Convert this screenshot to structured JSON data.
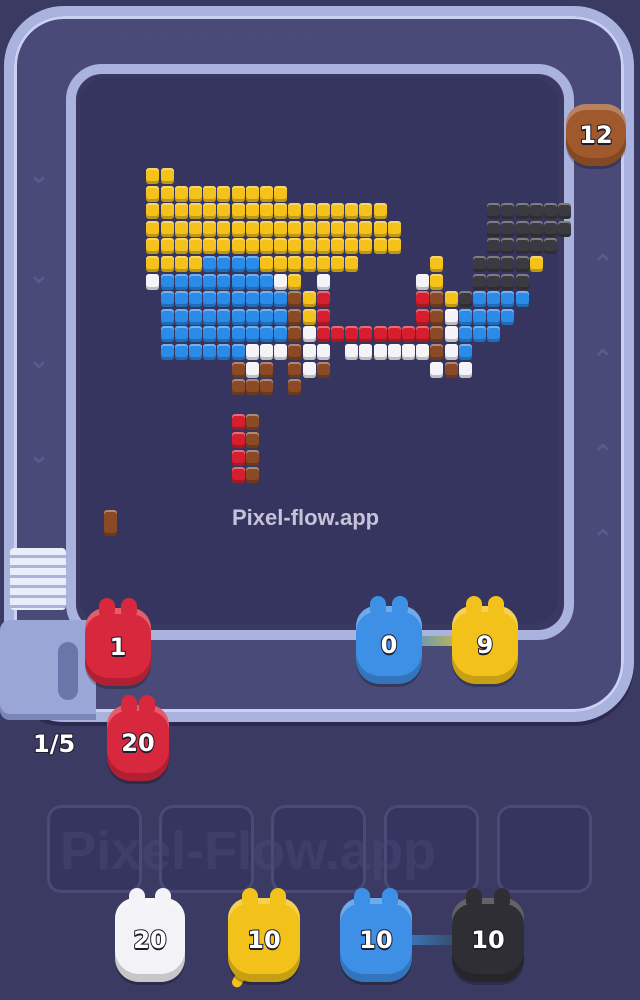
{
  "watermark": "Pixel-flow.app",
  "queue_counter": "1/5",
  "conveyor_shooters": [
    {
      "id": "brown-top",
      "count": "12",
      "color": "#a0582d"
    },
    {
      "id": "red-left",
      "count": "1",
      "color": "#d8283d"
    },
    {
      "id": "blue-mid",
      "count": "0",
      "color": "#3e8fe6"
    },
    {
      "id": "yellow-mid",
      "count": "9",
      "color": "#f2c21a"
    }
  ],
  "queue_shooter": {
    "count": "20",
    "color": "#d8283d"
  },
  "empty_slots": 5,
  "bottom_shooters": [
    {
      "count": "20",
      "color": "#f3f3f7"
    },
    {
      "count": "10",
      "color": "#f2c21a"
    },
    {
      "count": "10",
      "color": "#3e8fe6"
    },
    {
      "count": "10",
      "color": "#2e2e34"
    }
  ],
  "palette": {
    "Y": "#f4c21b",
    "B": "#2a8be8",
    "W": "#f4f4f8",
    "R": "#d61f2e",
    "N": "#8a4a25",
    "K": "#3a3a40"
  },
  "pixel_art": {
    "rows": [
      "..YY..........................",
      "..YYYYYYYYYY..................",
      "..YYYYYYYYYYYYYYYYY.......KKKKKK",
      "..YYYYYYYYYYYYYYYYYY......KKKKKK",
      "..YYYYYYYYYYYYYYYYYY......KKKKK.",
      "..YYYYBBBBYYYYYYY.....Y..KKKKY.",
      "..WBBBBBBBBWY.W......WY..KKKK..",
      "...BBBBBBBBBNYR......RNYKBBBB..",
      "...BBBBBBBBBNYR......RNWBBBB...",
      "...BBBBBBBBBNWRRRRRRRRNWBBB....",
      "...BBBBBBWWWNWW.WWWWWWNWB......",
      "........NWN.NWN.......WNW......",
      "........NNN.N..................",
      "...........................",
      "........RN.....................",
      "........RN.....................",
      "........RN.....................",
      "........RN....................."
    ]
  }
}
